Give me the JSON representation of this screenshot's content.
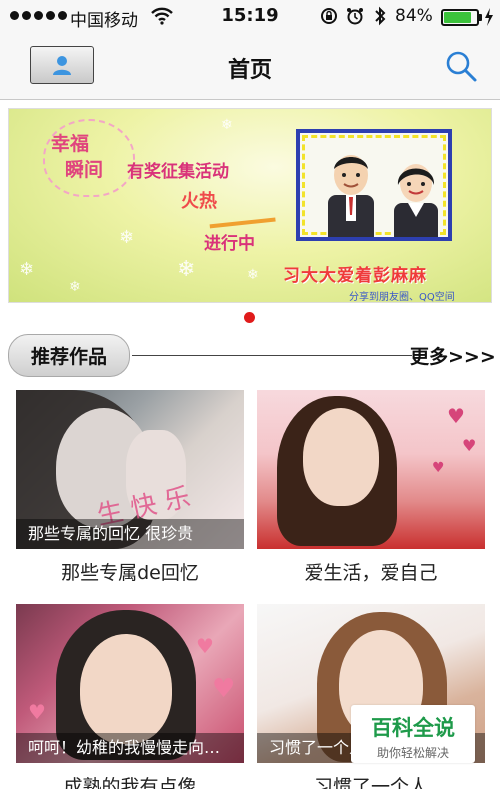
{
  "status_bar": {
    "carrier": "中国移动",
    "time": "15:19",
    "battery_percent": "84%",
    "battery_level": 0.84,
    "battery_color": "#3cc23c"
  },
  "nav": {
    "title": "首页",
    "profile_icon": "user-icon",
    "search_icon": "search-icon",
    "accent_color": "#2a7fd4"
  },
  "banner": {
    "texts": {
      "xingfu": "幸福",
      "shunjian": "瞬间",
      "youjiang": "有奖征集活动",
      "huore": "火热",
      "jinxing": "进行中",
      "title": "习大大爱着彭麻麻",
      "share": "分享到朋友圈、QQ空间"
    },
    "page_count": 1,
    "active_page": 1,
    "dot_color": "#e01b1b"
  },
  "section": {
    "tab_label": "推荐作品",
    "more_label": "更多>>>"
  },
  "cards": [
    {
      "overlay": "那些专属的回忆  很珍贵",
      "caption": "那些专属de回忆"
    },
    {
      "overlay": "",
      "caption": "爱生活，爱自己"
    },
    {
      "overlay": "呵呵！幼稚的我慢慢走向…",
      "caption": "成熟的我有点像"
    },
    {
      "overlay": "习惯了一个人",
      "caption": "习惯了一个人"
    }
  ],
  "watermark": {
    "title": "百科全说",
    "subtitle": "助你轻松解决"
  }
}
